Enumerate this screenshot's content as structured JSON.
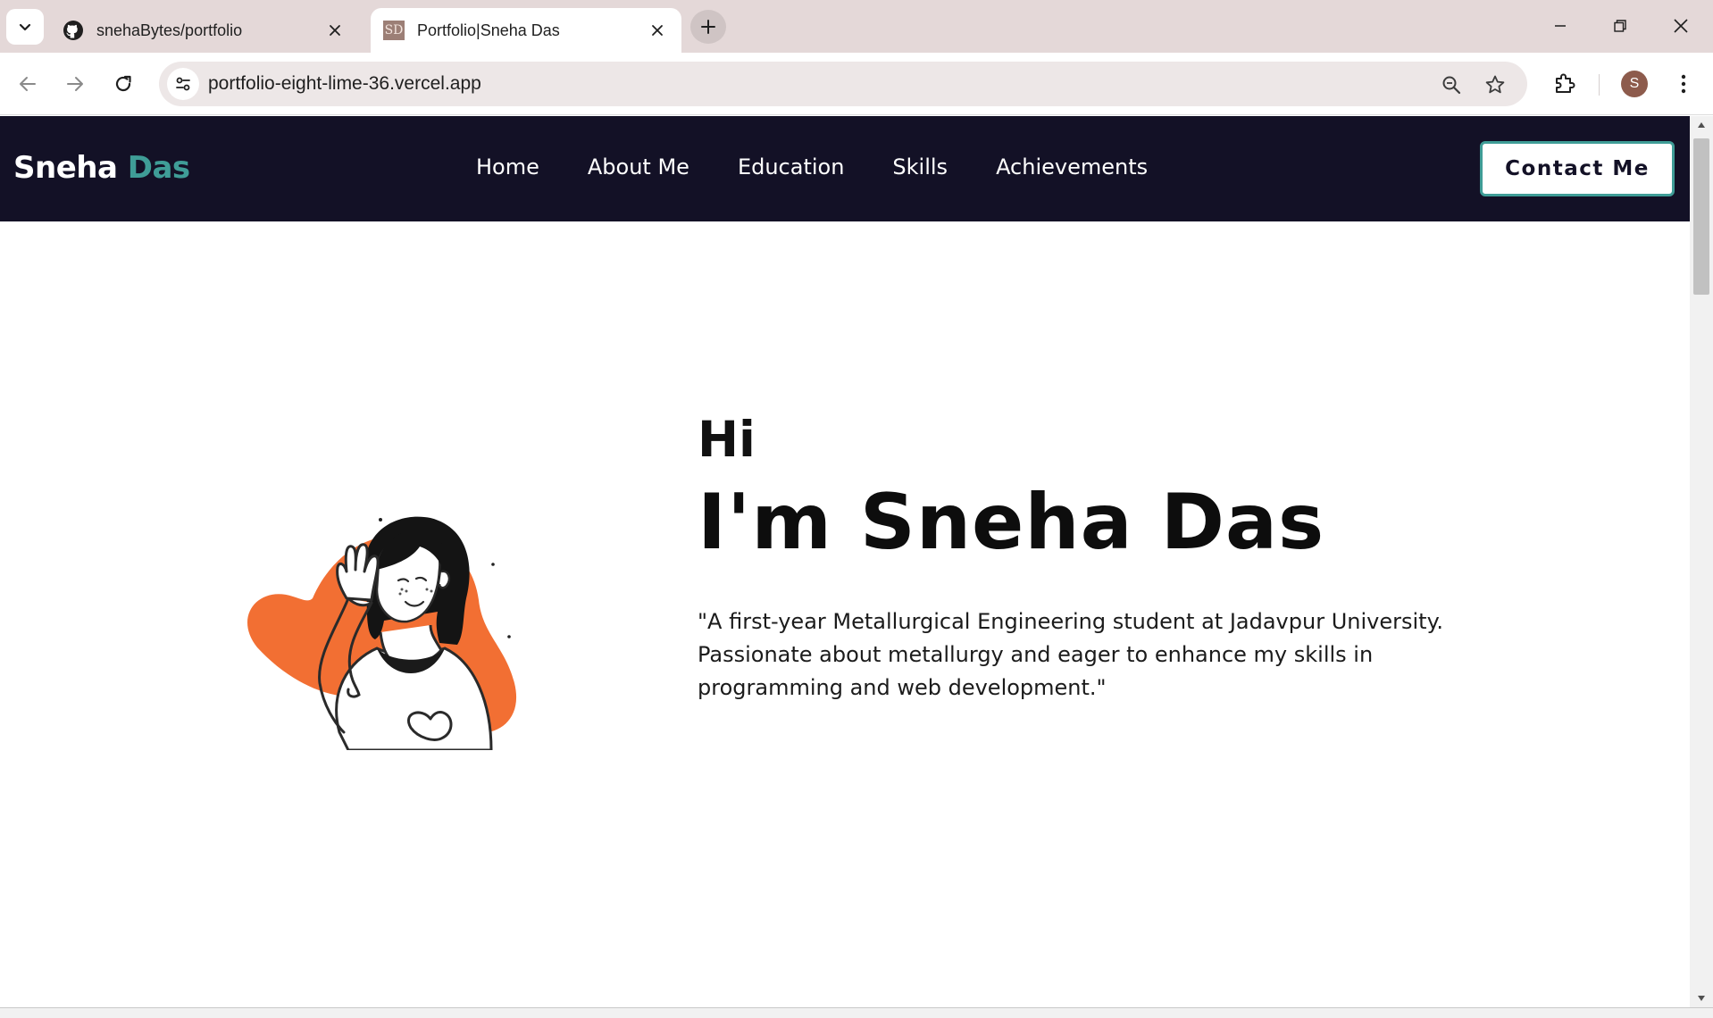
{
  "browser": {
    "tabs": [
      {
        "title": "snehaBytes/portfolio",
        "favicon": "github-icon",
        "active": false
      },
      {
        "title": "Portfolio|Sneha Das",
        "favicon_text": "SD",
        "active": true
      }
    ],
    "url": "portfolio-eight-lime-36.vercel.app",
    "profile_initial": "S"
  },
  "site": {
    "brand_first": "Sneha",
    "brand_second": "Das",
    "nav": [
      "Home",
      "About Me",
      "Education",
      "Skills",
      "Achievements"
    ],
    "contact_label": "Contact Me"
  },
  "hero": {
    "greeting": "Hi",
    "name": "I'm Sneha Das",
    "bio": "\"A first-year Metallurgical Engineering student at Jadavpur University. Passionate about metallurgy and eager to enhance my skills in programming and web development.\""
  },
  "colors": {
    "navbar_bg": "#131126",
    "accent_teal": "#3f9d97",
    "illustration_orange": "#f26f33",
    "tabbar_bg": "#e4d8d8"
  }
}
